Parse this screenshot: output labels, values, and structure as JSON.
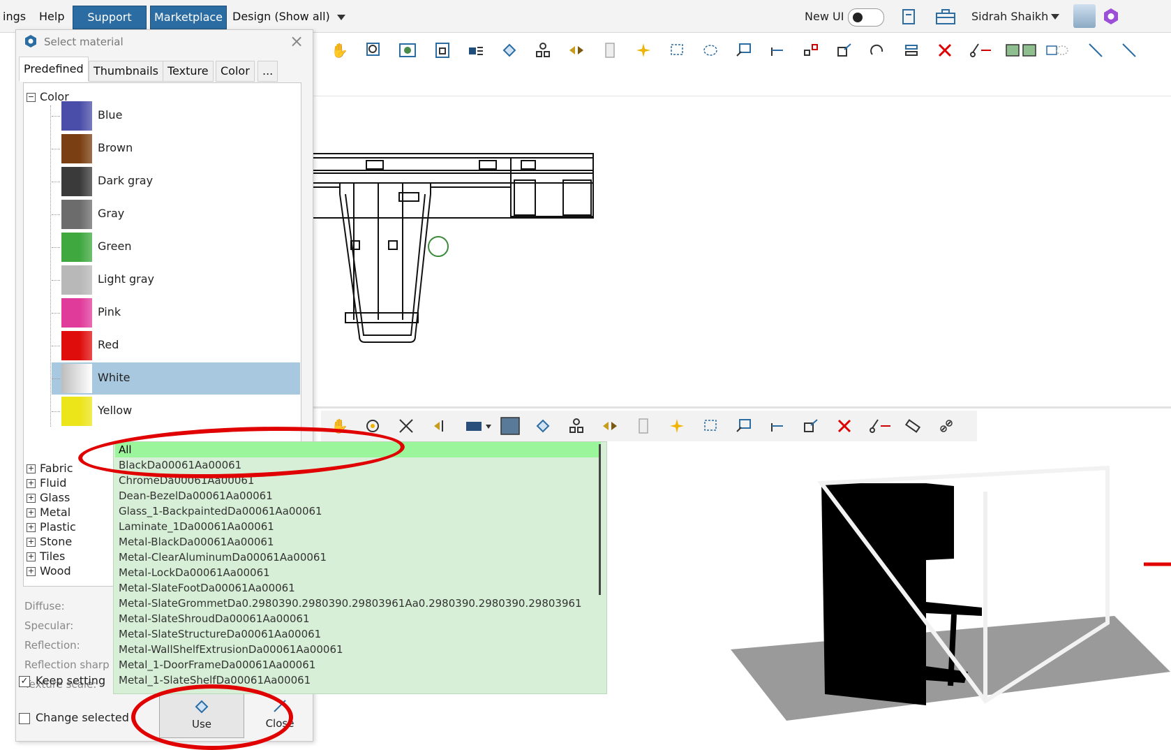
{
  "menubar": {
    "items": [
      "ings",
      "Help"
    ],
    "support": "Support",
    "marketplace": "Marketplace",
    "design_dropdown": "Design (Show all)",
    "new_ui": "New UI",
    "user_name": "Sidrah Shaikh"
  },
  "dialog": {
    "title": "Select material",
    "tabs": [
      "Predefined",
      "Thumbnails",
      "Texture",
      "Color",
      "..."
    ],
    "tree": {
      "root": "Color",
      "colors": [
        {
          "label": "Blue",
          "hex": "#4a4ea8"
        },
        {
          "label": "Brown",
          "hex": "#7a3f12"
        },
        {
          "label": "Dark gray",
          "hex": "#3a3a3a"
        },
        {
          "label": "Gray",
          "hex": "#6c6c6c"
        },
        {
          "label": "Green",
          "hex": "#3fa83f"
        },
        {
          "label": "Light gray",
          "hex": "#b8b8b8"
        },
        {
          "label": "Pink",
          "hex": "#e03a9a"
        },
        {
          "label": "Red",
          "hex": "#e00d0d"
        },
        {
          "label": "White",
          "hex": "#f2f2f2"
        },
        {
          "label": "Yellow",
          "hex": "#ece51a"
        }
      ],
      "selected": "White",
      "categories": [
        "Fabric",
        "Fluid",
        "Glass",
        "Metal",
        "Plastic",
        "Stone",
        "Tiles",
        "Wood"
      ]
    },
    "properties": [
      "Diffuse:",
      "Specular:",
      "Reflection:",
      "Reflection sharp",
      "Texture scale:"
    ],
    "keep_settings": "Keep setting",
    "change_selected": "Change selected",
    "use_button": "Use",
    "close_button": "Close"
  },
  "material_dropdown": {
    "highlighted": "All",
    "items": [
      "All",
      "BlackDa00061Aa00061",
      "ChromeDa00061Aa00061",
      "Dean-BezelDa00061Aa00061",
      "Glass_1-BackpaintedDa00061Aa00061",
      "Laminate_1Da00061Aa00061",
      "Metal-BlackDa00061Aa00061",
      "Metal-ClearAluminumDa00061Aa00061",
      "Metal-LockDa00061Aa00061",
      "Metal-SlateFootDa00061Aa00061",
      "Metal-SlateGrommetDa0.2980390.2980390.29803961Aa0.2980390.2980390.29803961",
      "Metal-SlateShroudDa00061Aa00061",
      "Metal-SlateStructureDa00061Aa00061",
      "Metal-WallShelfExtrusionDa00061Aa00061",
      "Metal_1-DoorFrameDa00061Aa00061",
      "Metal_1-SlateShelfDa00061Aa00061"
    ]
  },
  "colors": {
    "brand_blue": "#2b6ca3",
    "dropdown_bg": "#d6efd6",
    "dropdown_highlight": "#9bf59b",
    "selection": "#a8c8e0",
    "annotation_red": "#e00000"
  }
}
